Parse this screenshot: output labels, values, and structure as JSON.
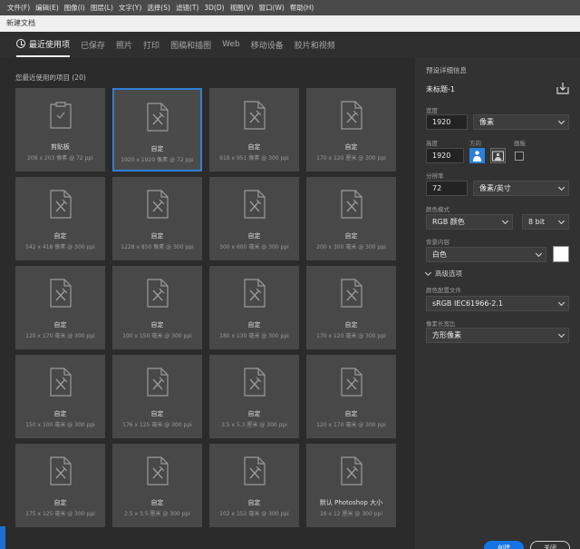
{
  "menu": [
    "文件(F)",
    "编辑(E)",
    "图像(I)",
    "图层(L)",
    "文字(Y)",
    "选择(S)",
    "滤镜(T)",
    "3D(D)",
    "视图(V)",
    "窗口(W)",
    "帮助(H)"
  ],
  "dialog": {
    "title": "新建文档"
  },
  "tabs": [
    "最近使用项",
    "已保存",
    "照片",
    "打印",
    "图稿和插图",
    "Web",
    "移动设备",
    "胶片和视频"
  ],
  "recent": {
    "header": "您最近使用的项目 (20)",
    "items": [
      {
        "label": "剪贴板",
        "size": "208 x 203 像素 @ 72 ppi",
        "icon": "clipboard"
      },
      {
        "label": "自定",
        "size": "1920 x 1920 像素 @ 72 ppi",
        "selected": true
      },
      {
        "label": "自定",
        "size": "918 x 951 像素 @ 300 ppi"
      },
      {
        "label": "自定",
        "size": "170 x 120 厘米 @ 300 ppi"
      },
      {
        "label": "自定",
        "size": "542 x 418 像素 @ 300 ppi"
      },
      {
        "label": "自定",
        "size": "1228 x 850 像素 @ 300 ppi"
      },
      {
        "label": "自定",
        "size": "300 x 600 毫米 @ 300 ppi"
      },
      {
        "label": "自定",
        "size": "200 x 300 毫米 @ 300 ppi"
      },
      {
        "label": "自定",
        "size": "120 x 170 毫米 @ 300 ppi"
      },
      {
        "label": "自定",
        "size": "100 x 150 毫米 @ 300 ppi"
      },
      {
        "label": "自定",
        "size": "180 x 130 毫米 @ 300 ppi"
      },
      {
        "label": "自定",
        "size": "170 x 120 毫米 @ 300 ppi"
      },
      {
        "label": "自定",
        "size": "150 x 100 毫米 @ 300 ppi"
      },
      {
        "label": "自定",
        "size": "176 x 125 毫米 @ 300 ppi"
      },
      {
        "label": "自定",
        "size": "3.5 x 5.3 厘米 @ 300 ppi"
      },
      {
        "label": "自定",
        "size": "120 x 170 毫米 @ 300 ppi"
      },
      {
        "label": "自定",
        "size": "175 x 125 毫米 @ 300 ppi"
      },
      {
        "label": "自定",
        "size": "2.5 x 3.5 厘米 @ 300 ppi"
      },
      {
        "label": "自定",
        "size": "102 x 152 毫米 @ 300 ppi"
      },
      {
        "label": "默认 Photoshop 大小",
        "size": "16 x 12 厘米 @ 300 ppi"
      }
    ]
  },
  "details": {
    "title": "预设详细信息",
    "doc_name": "未标题-1",
    "width_label": "宽度",
    "width_value": "1920",
    "width_unit": "像素",
    "height_label": "高度",
    "height_value": "1920",
    "orientation_label": "方向",
    "artboard_label": "画板",
    "resolution_label": "分辨率",
    "resolution_value": "72",
    "resolution_unit": "像素/英寸",
    "color_mode_label": "颜色模式",
    "color_mode_value": "RGB 颜色",
    "bit_depth": "8 bit",
    "background_label": "背景内容",
    "background_value": "白色",
    "background_swatch": "#ffffff",
    "advanced_label": "高级选项",
    "profile_label": "颜色配置文件",
    "profile_value": "sRGB IEC61966-2.1",
    "pixel_aspect_label": "像素长宽比",
    "pixel_aspect_value": "方形像素",
    "create_button": "创建",
    "close_button": "关闭"
  },
  "colors": {
    "accent": "#1473e6",
    "selection": "#2e7fd6"
  }
}
